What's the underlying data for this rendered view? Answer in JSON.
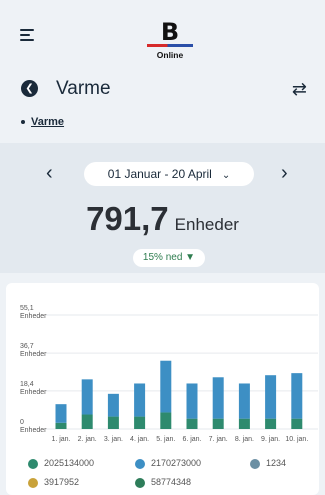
{
  "header": {
    "logo_letter": "B",
    "logo_sub": "Online"
  },
  "page": {
    "title": "Varme",
    "breadcrumb": "Varme"
  },
  "summary": {
    "date_range": "01 Januar - 20 April",
    "total_value": "791,7",
    "total_unit": "Enheder",
    "change": "15% ned"
  },
  "colors": {
    "series_green": "#2e8a6e",
    "series_blue": "#3d8fc4",
    "series_gray": "#6b8fa3",
    "series_yellow": "#c9a23a",
    "series_darkgreen": "#2e7d5a"
  },
  "chart_data": {
    "type": "bar",
    "stacked": true,
    "categories": [
      "1. jan.",
      "2. jan.",
      "3. jan.",
      "4. jan.",
      "5. jan.",
      "6. jan.",
      "7. jan.",
      "8. jan.",
      "9. jan.",
      "10. jan."
    ],
    "ytick_labels": [
      {
        "value": 0,
        "label": "0",
        "unit": "Enheder"
      },
      {
        "value": 18.4,
        "label": "18,4",
        "unit": "Enheder"
      },
      {
        "value": 36.7,
        "label": "36,7",
        "unit": "Enheder"
      },
      {
        "value": 55.1,
        "label": "55,1",
        "unit": "Enheder"
      }
    ],
    "ylim": [
      0,
      55.1
    ],
    "series": [
      {
        "name": "2025134000",
        "values": [
          3,
          7,
          6,
          6,
          8,
          5,
          5,
          5,
          5,
          5
        ]
      },
      {
        "name": "2170273000",
        "values": [
          9,
          17,
          11,
          16,
          25,
          17,
          20,
          17,
          21,
          22
        ]
      },
      {
        "name": "1234",
        "values": [
          0,
          0,
          0,
          0,
          0,
          0,
          0,
          0,
          0,
          0
        ]
      },
      {
        "name": "3917952",
        "values": [
          0,
          0,
          0,
          0,
          0,
          0,
          0,
          0,
          0,
          0
        ]
      },
      {
        "name": "58774348",
        "values": [
          0,
          0,
          0,
          0,
          0,
          0,
          0,
          0,
          0,
          0
        ]
      }
    ],
    "grid": true
  }
}
